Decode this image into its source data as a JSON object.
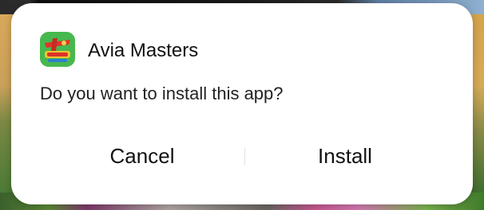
{
  "dialog": {
    "app_icon": "avia-masters-app-icon",
    "app_name": "Avia Masters",
    "question": "Do you want to install this app?",
    "cancel_label": "Cancel",
    "install_label": "Install"
  },
  "colors": {
    "dialog_background": "#ffffff",
    "text_primary": "#111111",
    "icon_green": "#3fae4b"
  }
}
